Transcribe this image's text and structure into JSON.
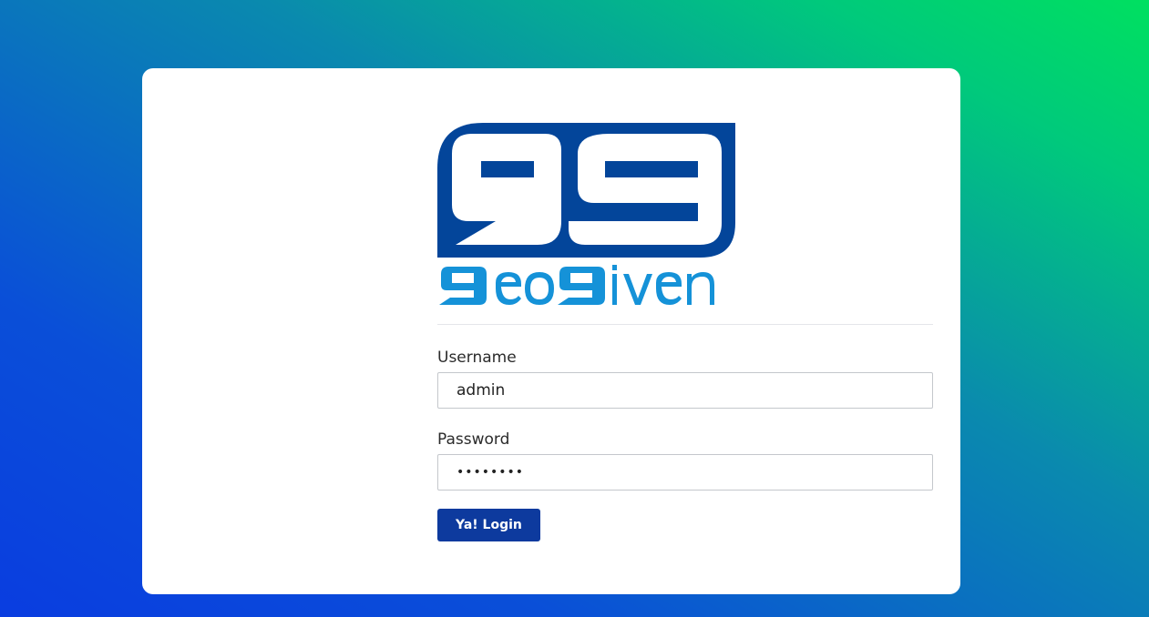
{
  "brand": {
    "logo_name": "geogiven-logo",
    "wordmark": "9eo9iven",
    "colors": {
      "dark_blue": "#03459a",
      "light_blue": "#1592d8"
    }
  },
  "form": {
    "username_label": "Username",
    "username_value": "admin",
    "password_label": "Password",
    "password_value": "password",
    "submit_label": "Ya! Login"
  },
  "colors": {
    "button": "#0d3a9e",
    "background_gradient": [
      "#0a3de0",
      "#00e060"
    ]
  }
}
